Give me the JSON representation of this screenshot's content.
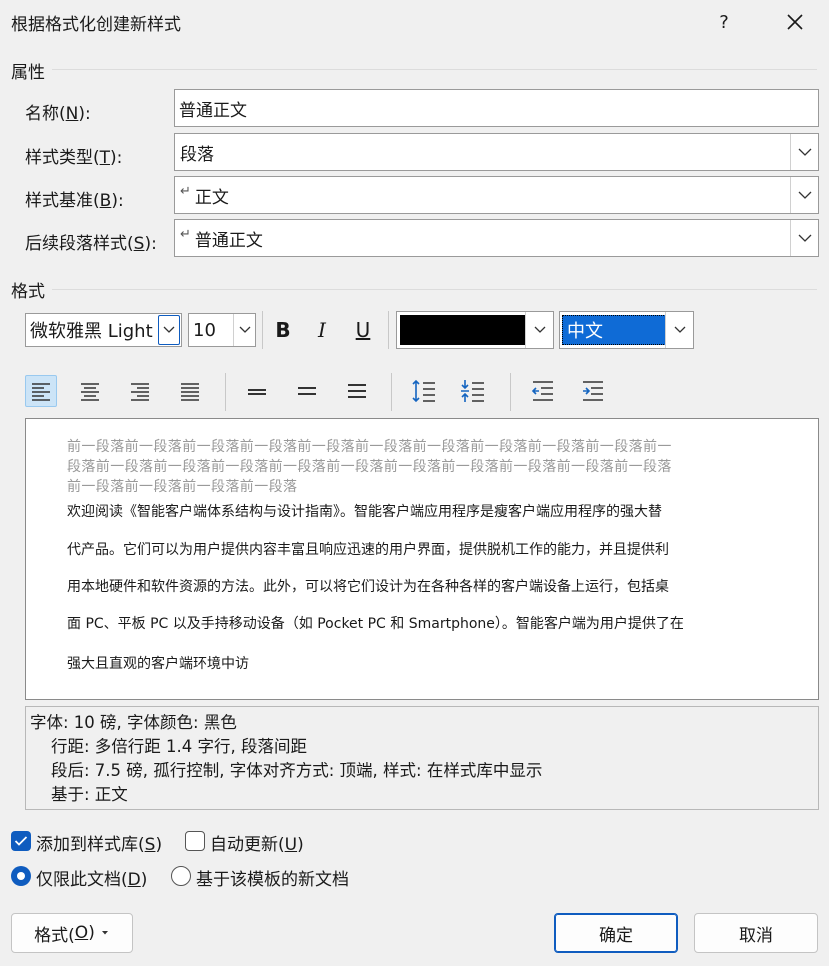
{
  "dialog": {
    "title": "根据格式化创建新样式",
    "help": "?",
    "close_icon": "close-icon"
  },
  "properties": {
    "section": "属性",
    "name_label": [
      "名称(",
      "N",
      "):"
    ],
    "name_value": "普通正文",
    "type_label": [
      "样式类型(",
      "T",
      "):"
    ],
    "type_value": "段落",
    "base_label": [
      "样式基准(",
      "B",
      "):"
    ],
    "base_value": "正文",
    "next_label": [
      "后续段落样式(",
      "S",
      "):"
    ],
    "next_value": "普通正文"
  },
  "format": {
    "section": "格式",
    "font": "微软雅黑 Light (",
    "size": "10",
    "bold": "B",
    "italic": "I",
    "underline": "U",
    "color": "#000000",
    "script": "中文"
  },
  "preview": {
    "previous_lines": [
      "前一段落前一段落前一段落前一段落前一段落前一段落前一段落前一段落前一段落前一段落前一",
      "段落前一段落前一段落前一段落前一段落前一段落前一段落前一段落前一段落前一段落前一段落",
      "前一段落前一段落前一段落前一段落"
    ],
    "sample_lines": [
      "欢迎阅读《智能客户端体系结构与设计指南》。智能客户端应用程序是瘦客户端应用程序的强大替",
      "代产品。它们可以为用户提供内容丰富且响应迅速的用户界面，提供脱机工作的能力，并且提供利",
      "用本地硬件和软件资源的方法。此外，可以将它们设计为在各种各样的客户端设备上运行，包括桌",
      "面 PC、平板 PC 以及手持移动设备（如 Pocket PC 和 Smartphone）。智能客户端为用户提供了在",
      "强大且直观的客户端环境中访"
    ]
  },
  "description": [
    "字体: 10 磅, 字体颜色: 黑色",
    "    行距: 多倍行距 1.4 字行, 段落间距",
    "    段后: 7.5 磅, 孤行控制, 字体对齐方式: 顶端, 样式: 在样式库中显示",
    "    基于: 正文"
  ],
  "options": {
    "add_to_gallery": [
      "添加到样式库(",
      "S",
      ")"
    ],
    "auto_update": [
      "自动更新(",
      "U",
      ")"
    ],
    "only_this_doc": [
      "仅限此文档(",
      "D",
      ")"
    ],
    "new_docs_template": "基于该模板的新文档"
  },
  "buttons": {
    "format": [
      "格式(",
      "O",
      ")"
    ],
    "ok": "确定",
    "cancel": "取消"
  },
  "colors": {
    "accent": "#0f5cbf",
    "selection": "#0f6bd6"
  }
}
